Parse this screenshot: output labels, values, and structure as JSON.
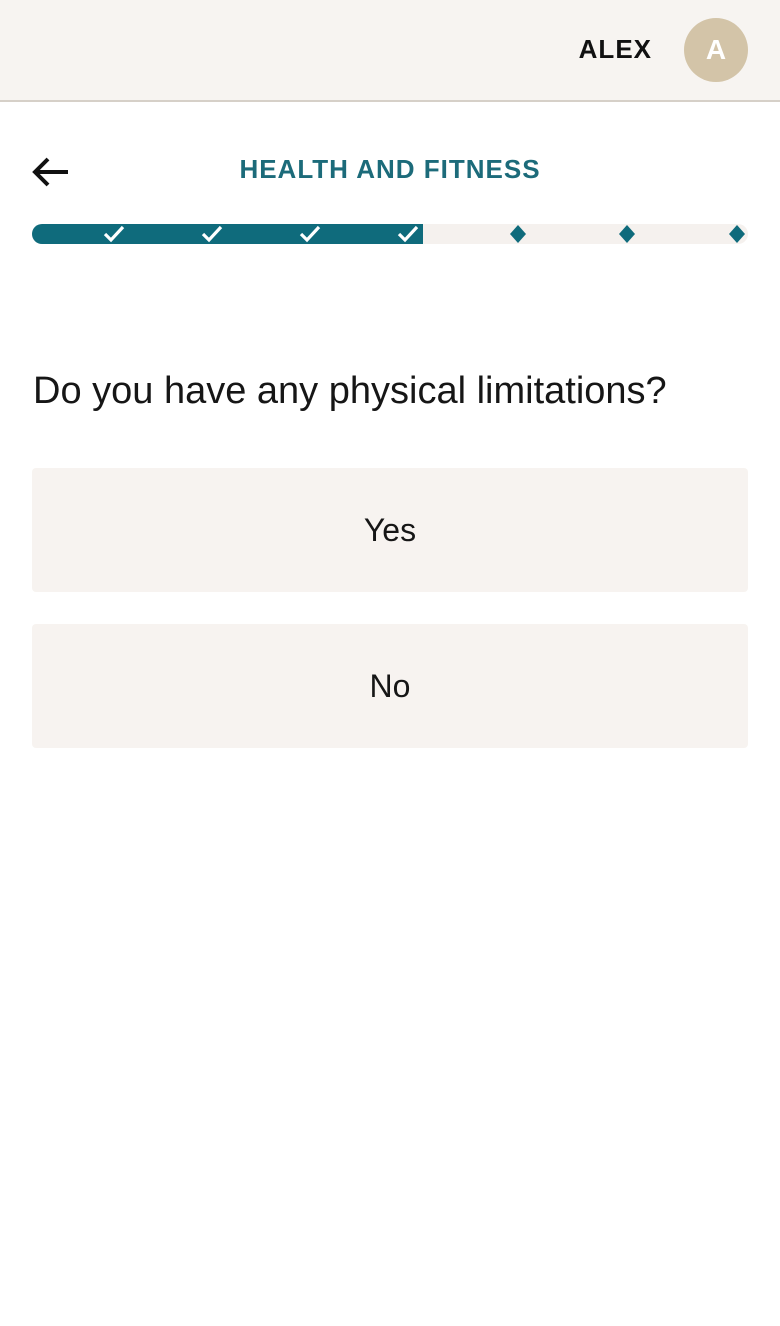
{
  "header": {
    "user_name": "ALEX",
    "avatar_initial": "A"
  },
  "page": {
    "title": "HEALTH AND FITNESS"
  },
  "progress": {
    "total_steps": 7,
    "completed_steps": 4,
    "accent_color": "#0f6b7c",
    "track_color": "#f5f1ee"
  },
  "question": {
    "text": "Do you have any physical limitations?",
    "options": [
      {
        "label": "Yes"
      },
      {
        "label": "No"
      }
    ]
  },
  "icons": {
    "back": "arrow-left-icon",
    "completed": "checkmark-icon",
    "pending": "diamond-icon"
  }
}
